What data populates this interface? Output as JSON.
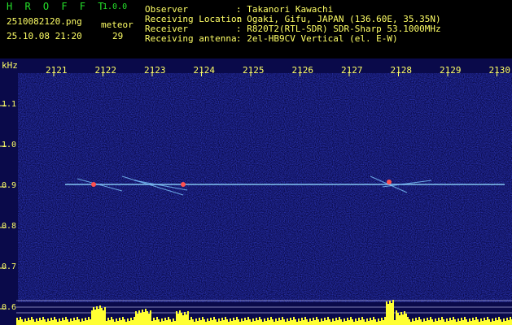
{
  "header": {
    "app_title": "H R O F F T",
    "version": "1.0.0",
    "file_name": "2510082120.png",
    "date_time": "25.10.08 21:20",
    "meteor_label": "meteor",
    "meteor_count": "29",
    "info": [
      {
        "key": "Observer",
        "value": ": Takanori Kawachi"
      },
      {
        "key": "Receiving Location",
        "value": ": Ogaki, Gifu, JAPAN (136.60E, 35.35N)"
      },
      {
        "key": "Receiver",
        "value": ": R820T2(RTL-SDR) SDR-Sharp 53.1000MHz"
      },
      {
        "key": "Receiving antenna",
        "value": ": 2el-HB9CV Vertical (el. E-W)"
      }
    ]
  },
  "plot": {
    "unit": "kHz",
    "y_ticks": [
      "1.1",
      "1.0",
      "0.9",
      "0.8",
      "0.7",
      "0.6"
    ],
    "x_ticks": [
      "2121",
      "2122",
      "2123",
      "2124",
      "2125",
      "2126",
      "2127",
      "2128",
      "2129",
      "2130"
    ],
    "colors": {
      "label": "#ffff66",
      "title": "#25e02a",
      "background": "#0a0a5a",
      "signal": "#7fd0ff"
    }
  }
}
